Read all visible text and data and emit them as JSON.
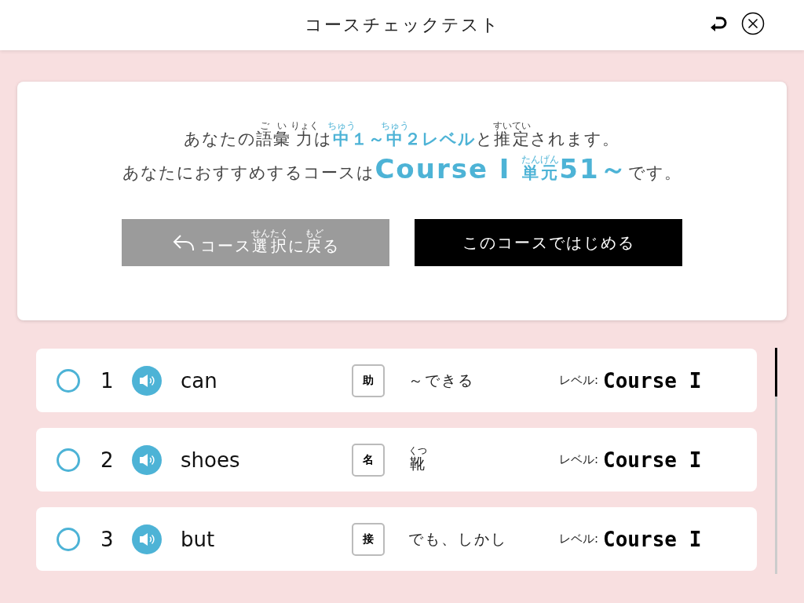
{
  "header": {
    "title": "コースチェックテスト"
  },
  "result": {
    "lines": [
      [
        {
          "kind": "plain",
          "text": "あなたの"
        },
        {
          "kind": "plain",
          "text": "語",
          "ruby": "ご"
        },
        {
          "kind": "plain",
          "text": "彙",
          "ruby": "い"
        },
        {
          "kind": "plain",
          "text": "力",
          "ruby": "りょく"
        },
        {
          "kind": "plain",
          "text": "は"
        },
        {
          "kind": "accent",
          "text": "中",
          "ruby": "ちゅう"
        },
        {
          "kind": "accent",
          "text": "１～"
        },
        {
          "kind": "accent",
          "text": "中",
          "ruby": "ちゅう"
        },
        {
          "kind": "accent",
          "text": "２レベル"
        },
        {
          "kind": "plain",
          "text": "と"
        },
        {
          "kind": "plain",
          "text": "推",
          "ruby": "すい"
        },
        {
          "kind": "plain",
          "text": "定",
          "ruby": "てい"
        },
        {
          "kind": "plain",
          "text": "されます。"
        }
      ],
      [
        {
          "kind": "plain",
          "text": "あなたにおすすめするコースは"
        },
        {
          "kind": "headline",
          "text": "Course I "
        },
        {
          "kind": "accent",
          "text": "単元",
          "ruby": "たんげん"
        },
        {
          "kind": "headline",
          "text": "51～"
        },
        {
          "kind": "plain",
          "text": "です。"
        }
      ]
    ]
  },
  "buttons": [
    {
      "kind": "back",
      "label": [
        {
          "text": "コース"
        },
        {
          "text": "選択",
          "ruby": "せんたく"
        },
        {
          "text": "に"
        },
        {
          "text": "戻",
          "ruby": "もど"
        },
        {
          "text": "る"
        }
      ]
    },
    {
      "kind": "primary",
      "label": [
        {
          "text": "このコースではじめる"
        }
      ]
    }
  ],
  "words": [
    {
      "checked": false,
      "number": "1",
      "word": "can",
      "part_of_speech": "助",
      "meaning": [
        {
          "text": "～できる"
        }
      ],
      "level_label": "レベル:",
      "level": "Course I"
    },
    {
      "checked": false,
      "number": "2",
      "word": "shoes",
      "part_of_speech": "名",
      "meaning": [
        {
          "text": "靴",
          "ruby": "くつ"
        }
      ],
      "level_label": "レベル:",
      "level": "Course I"
    },
    {
      "checked": false,
      "number": "3",
      "word": "but",
      "part_of_speech": "接",
      "meaning": [
        {
          "text": "でも、しかし"
        }
      ],
      "level_label": "レベル:",
      "level": "Course I"
    }
  ]
}
